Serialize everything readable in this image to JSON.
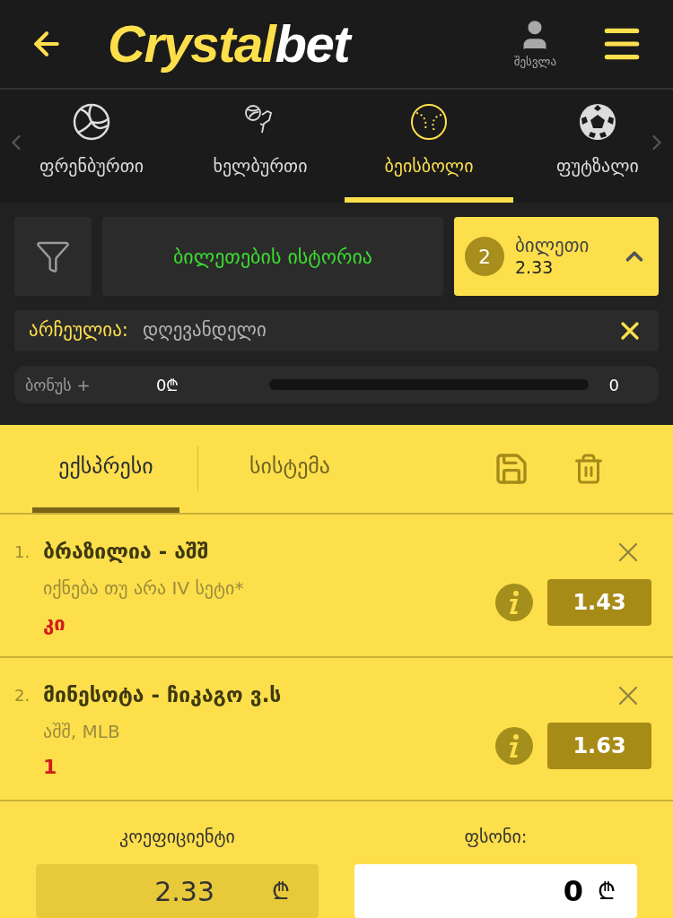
{
  "header": {
    "logo_main": "Crystal",
    "logo_accent": "bet",
    "account_label": "შესვლა"
  },
  "sports": [
    {
      "label": "ფრენბურთი",
      "kind": "volleyball",
      "selected": false
    },
    {
      "label": "ხელბურთი",
      "kind": "handball",
      "selected": false
    },
    {
      "label": "ბეისბოლი",
      "kind": "baseball",
      "selected": true
    },
    {
      "label": "ფუტზალი",
      "kind": "football",
      "selected": false
    }
  ],
  "history_button": "ბილეთების ისტორია",
  "ticket": {
    "count": "2",
    "label": "ბილეთი",
    "odds": "2.33"
  },
  "filter": {
    "label": "არჩეულია:",
    "value": "დღევანდელი"
  },
  "bonus": {
    "label": "ბონუს +",
    "amount": "0₾",
    "level": 0,
    "reading": "0"
  },
  "slip_tabs": [
    {
      "label": "ექსპრესი",
      "selected": true
    },
    {
      "label": "სისტემა",
      "selected": false
    }
  ],
  "bets": [
    {
      "number": "1.",
      "match": "ბრაზილია - აშშ",
      "market": "იქნება თუ არა IV სეტი*",
      "pick": "კი",
      "odds": "1.43"
    },
    {
      "number": "2.",
      "match": "მინესოტა - ჩიკაგო ვ.ს",
      "market": "აშშ, MLB",
      "pick": "1",
      "odds": "1.63"
    }
  ],
  "footer": {
    "coef_label": "კოეფიციენტი",
    "coef_value": "2.33",
    "currency": "₾",
    "stake_label": "ფსონი:",
    "stake_value": "0",
    "stake_currency": "₾"
  }
}
